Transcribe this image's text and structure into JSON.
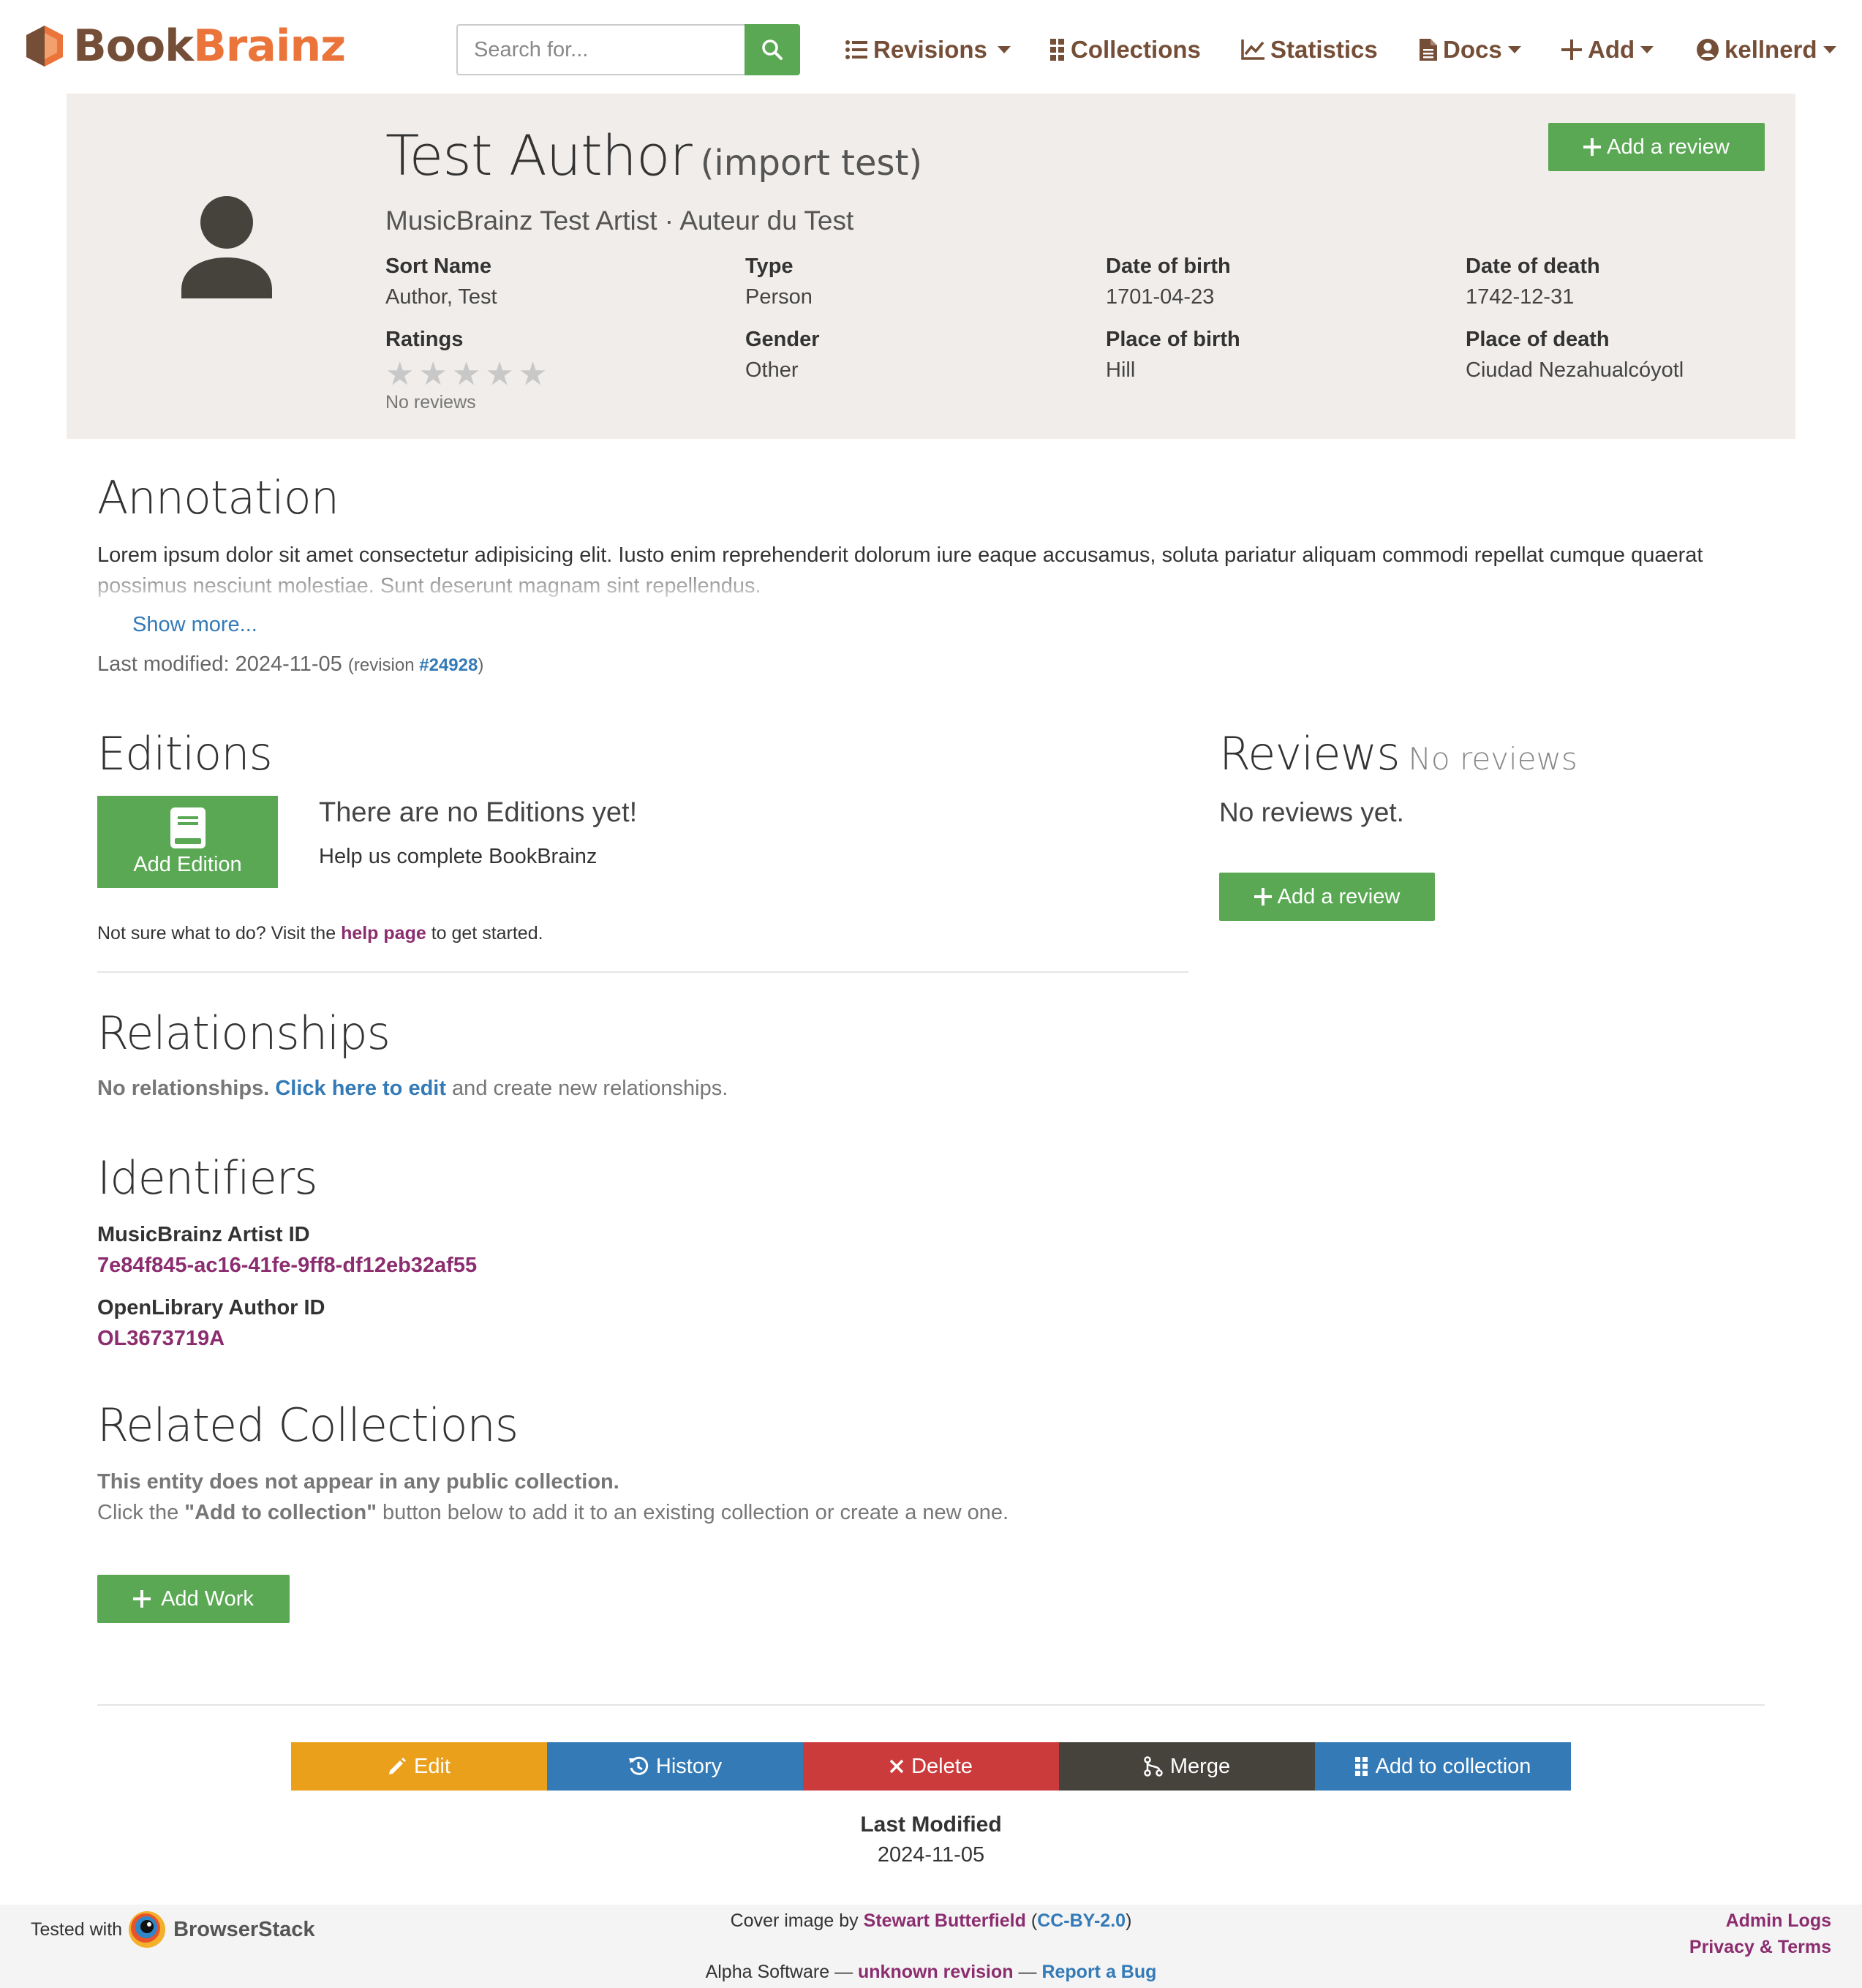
{
  "navbar": {
    "logo_book": "Book",
    "logo_brainz": "Brainz",
    "search_placeholder": "Search for...",
    "items": [
      {
        "label": "Revisions",
        "icon": "list-icon",
        "dropdown": true
      },
      {
        "label": "Collections",
        "icon": "grid-icon",
        "dropdown": false
      },
      {
        "label": "Statistics",
        "icon": "chart-line-icon",
        "dropdown": false
      },
      {
        "label": "Docs",
        "icon": "file-icon",
        "dropdown": true
      },
      {
        "label": "Add",
        "icon": "plus-icon",
        "dropdown": true
      },
      {
        "label": "kellnerd",
        "icon": "user-circle-icon",
        "dropdown": true
      }
    ]
  },
  "header": {
    "title": "Test Author",
    "disambiguation": "(import test)",
    "aliases": "MusicBrainz Test Artist · Auteur du Test",
    "add_review_label": "Add a review",
    "fields": {
      "sort_name_label": "Sort Name",
      "sort_name": "Author, Test",
      "type_label": "Type",
      "type": "Person",
      "dob_label": "Date of birth",
      "dob": "1701-04-23",
      "dod_label": "Date of death",
      "dod": "1742-12-31",
      "ratings_label": "Ratings",
      "rating_stars": 0,
      "ratings_sub": "No reviews",
      "gender_label": "Gender",
      "gender": "Other",
      "pob_label": "Place of birth",
      "pob": "Hill",
      "pod_label": "Place of death",
      "pod": "Ciudad Nezahualcóyotl"
    }
  },
  "annotation": {
    "heading": "Annotation",
    "text": "Lorem ipsum dolor sit amet consectetur adipisicing elit. Iusto enim reprehenderit dolorum iure eaque accusamus, soluta pariatur aliquam commodi repellat cumque quaerat possimus nesciunt molestiae. Sunt deserunt magnam sint repellendus.",
    "show_more": "Show more...",
    "last_modified_label": "Last modified: 2024-11-05",
    "revision_prefix": "(revision ",
    "revision": "#24928",
    "revision_suffix": ")"
  },
  "editions": {
    "heading": "Editions",
    "add_label": "Add Edition",
    "empty_title": "There are no Editions yet!",
    "empty_sub": "Help us complete BookBrainz",
    "help_prefix": "Not sure what to do? Visit the ",
    "help_link": "help page",
    "help_suffix": " to get started."
  },
  "reviews": {
    "heading": "Reviews",
    "heading_sub": "No reviews",
    "empty": "No reviews yet.",
    "add_label": "Add a review"
  },
  "relationships": {
    "heading": "Relationships",
    "bold": "No relationships.",
    "link": "Click here to edit",
    "rest": " and create new relationships."
  },
  "identifiers": {
    "heading": "Identifiers",
    "items": [
      {
        "label": "MusicBrainz Artist ID",
        "value": "7e84f845-ac16-41fe-9ff8-df12eb32af55"
      },
      {
        "label": "OpenLibrary Author ID",
        "value": "OL3673719A"
      }
    ]
  },
  "collections": {
    "heading": "Related Collections",
    "line1": "This entity does not appear in any public collection.",
    "line2_prefix": "Click the ",
    "line2_bold": "\"Add to collection\"",
    "line2_suffix": " button below to add it to an existing collection or create a new one.",
    "add_work_label": "Add Work"
  },
  "actions": {
    "edit": "Edit",
    "history": "History",
    "delete": "Delete",
    "merge": "Merge",
    "add_to_collection": "Add to collection",
    "colors": {
      "edit": "#eba01c",
      "history": "#337ab7",
      "delete": "#cc3b3b",
      "merge": "#46433d",
      "collection": "#337ab7"
    }
  },
  "last_modified": {
    "label": "Last Modified",
    "value": "2024-11-05"
  },
  "footer": {
    "tested_with": "Tested with",
    "browserstack": "BrowserStack",
    "cover_prefix": "Cover image by ",
    "cover_author": "Stewart Butterfield",
    "cover_open": " (",
    "cover_license": "CC-BY-2.0",
    "cover_close": ")",
    "admin_logs": "Admin Logs",
    "privacy_terms": "Privacy & Terms",
    "alpha_prefix": "Alpha Software — ",
    "alpha_revision": "unknown revision",
    "alpha_sep": " — ",
    "report_bug": "Report a Bug"
  },
  "colors": {
    "brand_brown": "#754e37",
    "brand_orange": "#eb743b",
    "green": "#5aa854",
    "link_blue": "#337ab7",
    "link_purple": "#8b2d6f"
  }
}
